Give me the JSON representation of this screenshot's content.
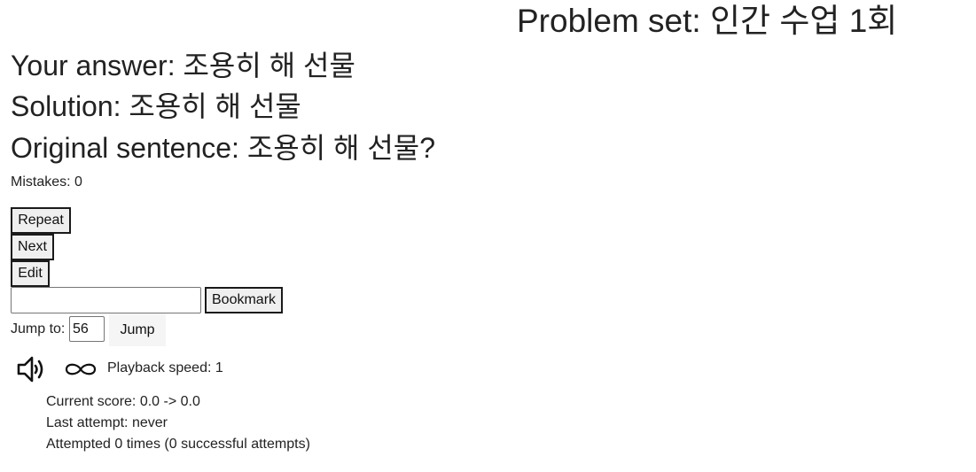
{
  "header": {
    "title": "Problem set: 인간 수업 1회"
  },
  "result": {
    "answer_label": "Your answer: ",
    "answer_value": "조용히 해 선물",
    "solution_label": "Solution: ",
    "solution_value": "조용히 해 선물",
    "original_label": "Original sentence: ",
    "original_value": "조용히 해 선물?",
    "mistakes_text": "Mistakes: 0"
  },
  "actions": {
    "repeat_label": "Repeat",
    "next_label": "Next",
    "edit_label": "Edit",
    "bookmark_value": "",
    "bookmark_label": "Bookmark"
  },
  "jump": {
    "label": "Jump to:",
    "value": "56",
    "button_label": "Jump"
  },
  "playback": {
    "speaker_icon": "speaker-volume-icon",
    "loop_icon": "infinity-loop-icon",
    "speed_text": "Playback speed: 1"
  },
  "stats": {
    "score_text": "Current score: 0.0 -> 0.0",
    "last_attempt_text": "Last attempt: never",
    "attempts_text": "Attempted 0 times (0 successful attempts)"
  }
}
